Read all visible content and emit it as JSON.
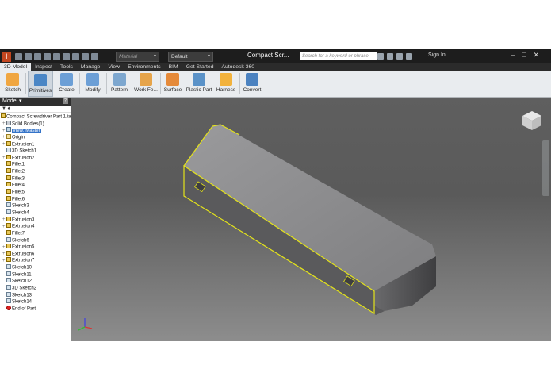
{
  "titlebar": {
    "logo": "I",
    "material_placeholder": "Material",
    "appearance_value": "Default",
    "document_title": "Compact Scr...",
    "search_placeholder": "Search for a keyword or phrase",
    "sign_in": "Sign In",
    "window_buttons": "–□✕"
  },
  "tabs": [
    {
      "label": "3D Model",
      "active": true
    },
    {
      "label": "Inspect"
    },
    {
      "label": "Tools"
    },
    {
      "label": "Manage"
    },
    {
      "label": "View"
    },
    {
      "label": "Environments"
    },
    {
      "label": "BIM"
    },
    {
      "label": "Get Started"
    },
    {
      "label": "Autodesk 360"
    }
  ],
  "ribbon": [
    {
      "label": "Sketch",
      "color": "#f0a640"
    },
    {
      "label": "Primitives",
      "color": "#4a86c5"
    },
    {
      "label": "Create",
      "color": "#6c9fd6"
    },
    {
      "label": "Modify",
      "color": "#6c9fd6"
    },
    {
      "label": "Pattern",
      "color": "#7da7cf"
    },
    {
      "label": "Work Fe...",
      "color": "#e6a44a"
    },
    {
      "label": "Surface",
      "color": "#e58a3a"
    },
    {
      "label": "Plastic Part",
      "color": "#5a92c8"
    },
    {
      "label": "Harness",
      "color": "#f2b23c"
    },
    {
      "label": "Convert",
      "color": "#4b82c0"
    }
  ],
  "browser": {
    "title": "Model",
    "help": "?",
    "toolbar": "▼  ♠",
    "tree": [
      {
        "label": "Compact Screwdriver Part 1.ia",
        "icon": "part",
        "indent": 0
      },
      {
        "label": "Solid Bodies(1)",
        "icon": "solid",
        "indent": 1,
        "expander": "+"
      },
      {
        "label": "View: Master",
        "icon": "view",
        "indent": 1,
        "expander": "+",
        "selected": true
      },
      {
        "label": "Origin",
        "icon": "orig",
        "indent": 1,
        "expander": "+"
      },
      {
        "label": "Extrusion1",
        "icon": "feat",
        "indent": 1,
        "expander": "+"
      },
      {
        "label": "3D Sketch1",
        "icon": "sk",
        "indent": 1
      },
      {
        "label": "Extrusion2",
        "icon": "feat",
        "indent": 1,
        "expander": "+"
      },
      {
        "label": "Fillet1",
        "icon": "feat",
        "indent": 1
      },
      {
        "label": "Fillet2",
        "icon": "feat",
        "indent": 1
      },
      {
        "label": "Fillet3",
        "icon": "feat",
        "indent": 1
      },
      {
        "label": "Fillet4",
        "icon": "feat",
        "indent": 1
      },
      {
        "label": "Fillet5",
        "icon": "feat",
        "indent": 1
      },
      {
        "label": "Fillet6",
        "icon": "feat",
        "indent": 1
      },
      {
        "label": "Sketch3",
        "icon": "sk",
        "indent": 1
      },
      {
        "label": "Sketch4",
        "icon": "sk",
        "indent": 1
      },
      {
        "label": "Extrusion3",
        "icon": "feat",
        "indent": 1,
        "expander": "+"
      },
      {
        "label": "Extrusion4",
        "icon": "feat",
        "indent": 1,
        "expander": "+"
      },
      {
        "label": "Fillet7",
        "icon": "feat",
        "indent": 1
      },
      {
        "label": "Sketch6",
        "icon": "sk",
        "indent": 1
      },
      {
        "label": "Extrusion5",
        "icon": "feat",
        "indent": 1,
        "expander": "+"
      },
      {
        "label": "Extrusion6",
        "icon": "feat",
        "indent": 1,
        "expander": "+"
      },
      {
        "label": "Extrusion7",
        "icon": "feat",
        "indent": 1,
        "expander": "+"
      },
      {
        "label": "Sketch10",
        "icon": "sk",
        "indent": 1
      },
      {
        "label": "Sketch11",
        "icon": "sk",
        "indent": 1
      },
      {
        "label": "Sketch12",
        "icon": "sk",
        "indent": 1
      },
      {
        "label": "3D Sketch2",
        "icon": "sk",
        "indent": 1
      },
      {
        "label": "Sketch13",
        "icon": "sk",
        "indent": 1
      },
      {
        "label": "Sketch14",
        "icon": "sk",
        "indent": 1
      },
      {
        "label": "End of Part",
        "icon": "end",
        "indent": 1
      }
    ]
  },
  "colors": {
    "highlight_edge": "#e3e21b",
    "body_top": "#8a8a8c",
    "body_side": "#505052"
  }
}
